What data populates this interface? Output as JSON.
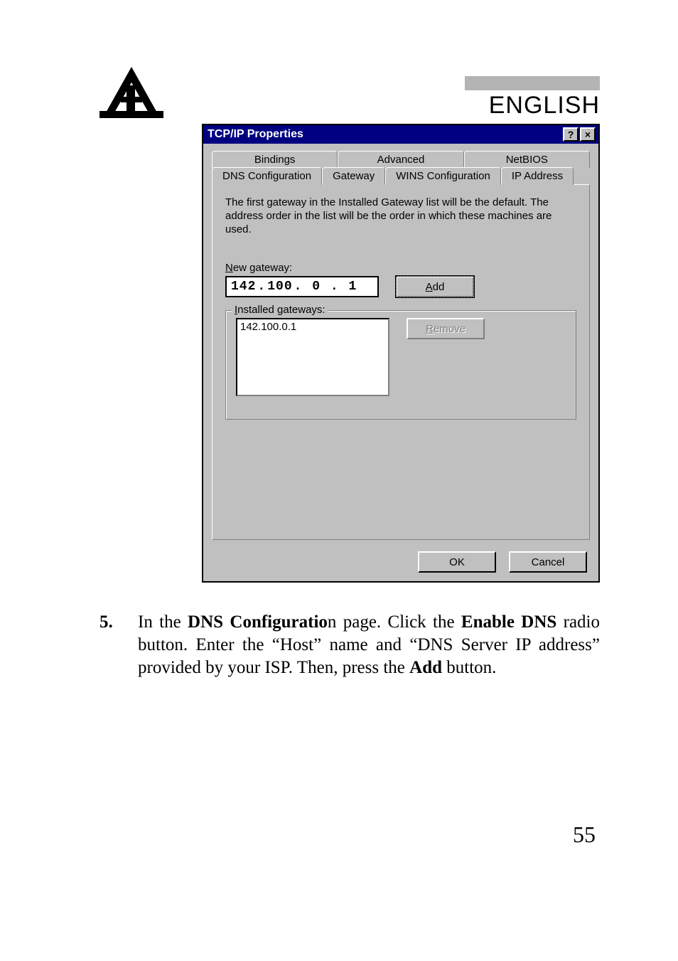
{
  "header": {
    "language_label": "ENGLISH"
  },
  "dialog": {
    "title": "TCP/IP Properties",
    "help_glyph": "?",
    "close_glyph": "×",
    "tabs_row1": [
      "Bindings",
      "Advanced",
      "NetBIOS"
    ],
    "tabs_row2": [
      "DNS Configuration",
      "Gateway",
      "WINS Configuration",
      "IP Address"
    ],
    "active_tab": "Gateway",
    "help_text": "The first gateway in the Installed Gateway list will be the default. The address order in the list will be the order in which these machines are used.",
    "new_gateway_label_pre": "N",
    "new_gateway_label_post": "ew gateway:",
    "ip_octets": [
      "142",
      "100",
      "0",
      "1"
    ],
    "add_label_pre": "A",
    "add_label_post": "dd",
    "installed_label_pre": "I",
    "installed_label_post": "nstalled gateways:",
    "installed_list": [
      "142.100.0.1"
    ],
    "remove_label_pre": "R",
    "remove_label_post": "emove",
    "ok_label": "OK",
    "cancel_label": "Cancel"
  },
  "instruction": {
    "number": "5.",
    "text_parts": {
      "p1": "In the ",
      "b1": "DNS Configuratio",
      "p2": "n page. Click the ",
      "b2": "Enable DNS",
      "p3": " radio button. Enter the “Host” name and “DNS Server IP address” provided by your ISP. Then, press the ",
      "b3": "Add",
      "p4": " button."
    }
  },
  "page_number": "55"
}
